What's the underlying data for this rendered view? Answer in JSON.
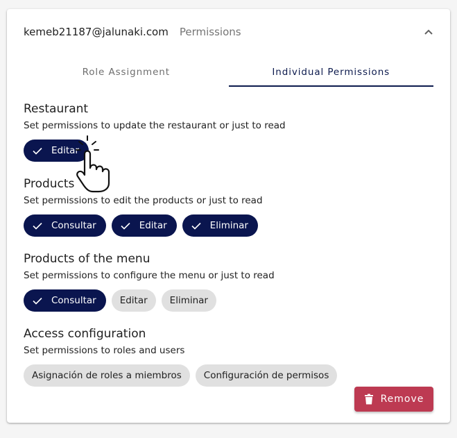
{
  "header": {
    "email": "kemeb21187@jalunaki.com",
    "subtitle": "Permissions",
    "collapse_icon": "chevron-up-icon"
  },
  "tabs": [
    {
      "label": "Role Assignment",
      "active": false
    },
    {
      "label": "Individual Permissions",
      "active": true
    }
  ],
  "sections": {
    "restaurant": {
      "title": "Restaurant",
      "description": "Set permissions to update the restaurant or just to read",
      "chips": [
        {
          "label": "Editar",
          "selected": true
        }
      ]
    },
    "products": {
      "title": "Products",
      "description": "Set permissions to edit the products or just to read",
      "chips": [
        {
          "label": "Consultar",
          "selected": true
        },
        {
          "label": "Editar",
          "selected": true
        },
        {
          "label": "Eliminar",
          "selected": true
        }
      ]
    },
    "menu": {
      "title": "Products of the menu",
      "description": "Set permissions to configure the menu or just to read",
      "chips": [
        {
          "label": "Consultar",
          "selected": true
        },
        {
          "label": "Editar",
          "selected": false
        },
        {
          "label": "Eliminar",
          "selected": false
        }
      ]
    },
    "access": {
      "title": "Access configuration",
      "description": "Set permissions to roles and users",
      "chips": [
        {
          "label": "Asignación de roles a miembros",
          "selected": false
        },
        {
          "label": "Configuración de permisos",
          "selected": false
        }
      ]
    }
  },
  "actions": {
    "remove_label": "Remove",
    "remove_icon": "trash-icon"
  },
  "colors": {
    "primary": "#0a154f",
    "danger": "#bd3a52",
    "chip_unselected": "#e0e0e0"
  },
  "cursor": "hand-pointer-icon"
}
